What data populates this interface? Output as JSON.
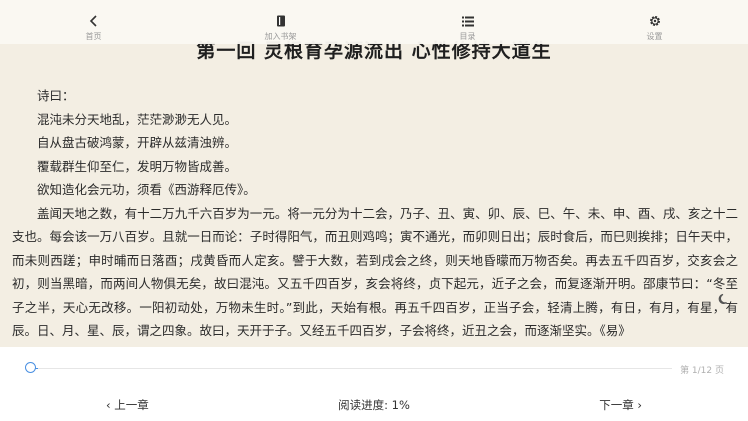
{
  "top_nav": {
    "items": [
      {
        "label": "首页",
        "icon": "chevron-left-icon"
      },
      {
        "label": "加入书架",
        "icon": "book-icon"
      },
      {
        "label": "目录",
        "icon": "list-icon"
      },
      {
        "label": "设置",
        "icon": "gear-icon"
      }
    ]
  },
  "reader": {
    "chapter_title": "第一回 灵根育孕源流出 心性修持大道生",
    "poem": [
      "诗曰：",
      "混沌未分天地乱，茫茫渺渺无人见。",
      "自从盘古破鸿蒙，开辟从兹清浊辨。",
      "覆载群生仰至仁，发明万物皆成善。",
      "欲知造化会元功，须看《西游释厄传》。"
    ],
    "paragraph": "盖闻天地之数，有十二万九千六百岁为一元。将一元分为十二会，乃子、丑、寅、卯、辰、巳、午、未、申、酉、戌、亥之十二支也。每会该一万八百岁。且就一日而论：子时得阳气，而丑则鸡鸣；寅不通光，而卯则日出；辰时食后，而巳则挨排；日午天中，而未则西蹉；申时晡而日落酉；戌黄昏而人定亥。譬于大数，若到戌会之终，则天地昏曚而万物否矣。再去五千四百岁，交亥会之初，则当黑暗，而两间人物俱无矣，故曰混沌。又五千四百岁，亥会将终，贞下起元，近子之会，而复逐渐开明。邵康节曰：“冬至子之半，天心无改移。一阳初动处，万物未生时。”到此，天始有根。再五千四百岁，正当子会，轻清上腾，有日，有月，有星，有辰。日、月、星、辰，谓之四象。故曰，天开于子。又经五千四百岁，子会将终，近丑之会，而逐渐坚实。《易》"
  },
  "bottom_bar": {
    "page_indicator": "第 1/12 页",
    "prev_label": "‹ 上一章",
    "reading_progress": "阅读进度: 1%",
    "next_label": "下一章 ›",
    "progress_fraction": 0.01
  },
  "colors": {
    "background": "#f3eee3",
    "accent": "#4a90e2"
  }
}
